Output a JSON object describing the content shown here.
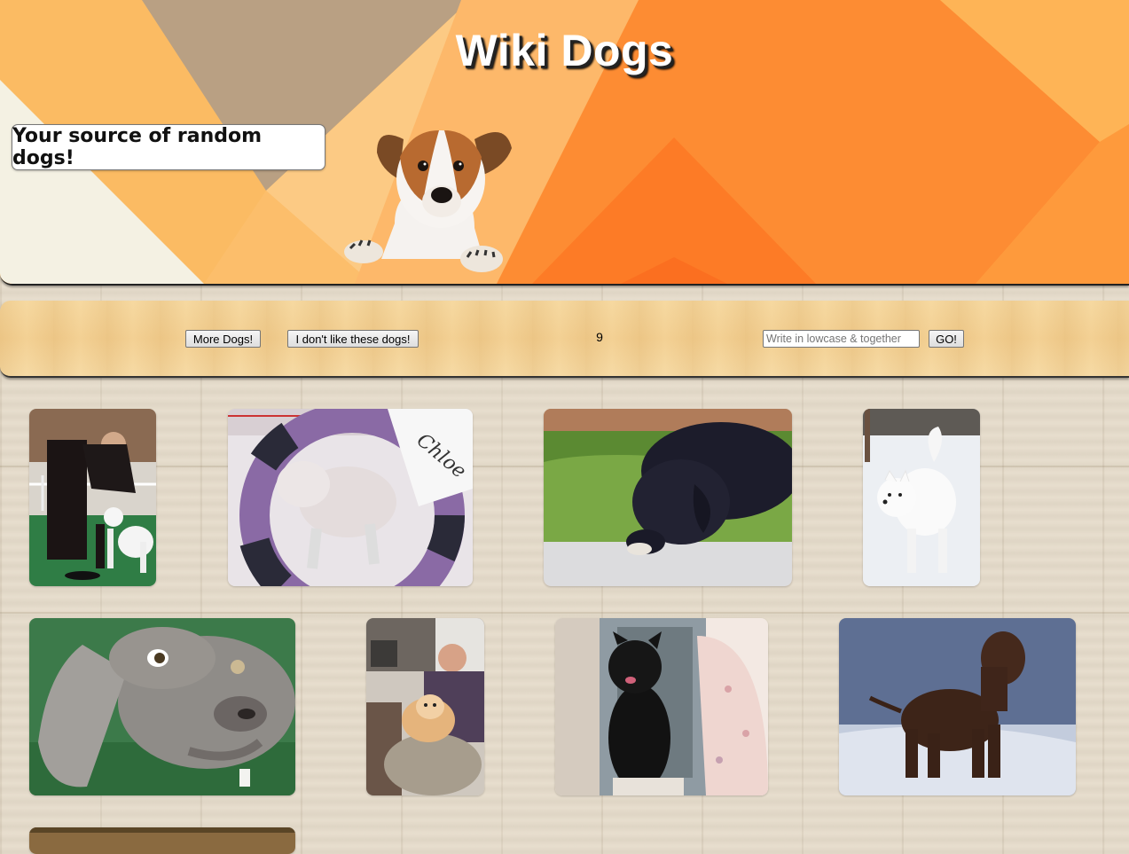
{
  "header": {
    "title": "Wiki Dogs",
    "tagline": "Your source of random dogs!",
    "colors": {
      "orange": "#fd8a2e",
      "light_orange": "#fcc27a",
      "taupe": "#b8a084",
      "cream": "#f5f2e4"
    }
  },
  "toolbar": {
    "more_label": "More Dogs!",
    "dislike_label": "I don't like these dogs!",
    "counter": "9",
    "search_placeholder": "Write in lowcase & together",
    "go_label": "GO!"
  },
  "gallery": {
    "images": [
      {
        "subject": "dog-photo-poodle-show"
      },
      {
        "subject": "dog-photo-bedlington-agility"
      },
      {
        "subject": "dog-photo-black-puppy-grass"
      },
      {
        "subject": "dog-photo-white-dog-snow"
      },
      {
        "subject": "dog-photo-weimaraner"
      },
      {
        "subject": "dog-photo-pomeranian-lap"
      },
      {
        "subject": "dog-photo-black-terrier"
      },
      {
        "subject": "dog-photo-brown-water-spaniel"
      },
      {
        "subject": "dog-photo-partial"
      }
    ]
  }
}
